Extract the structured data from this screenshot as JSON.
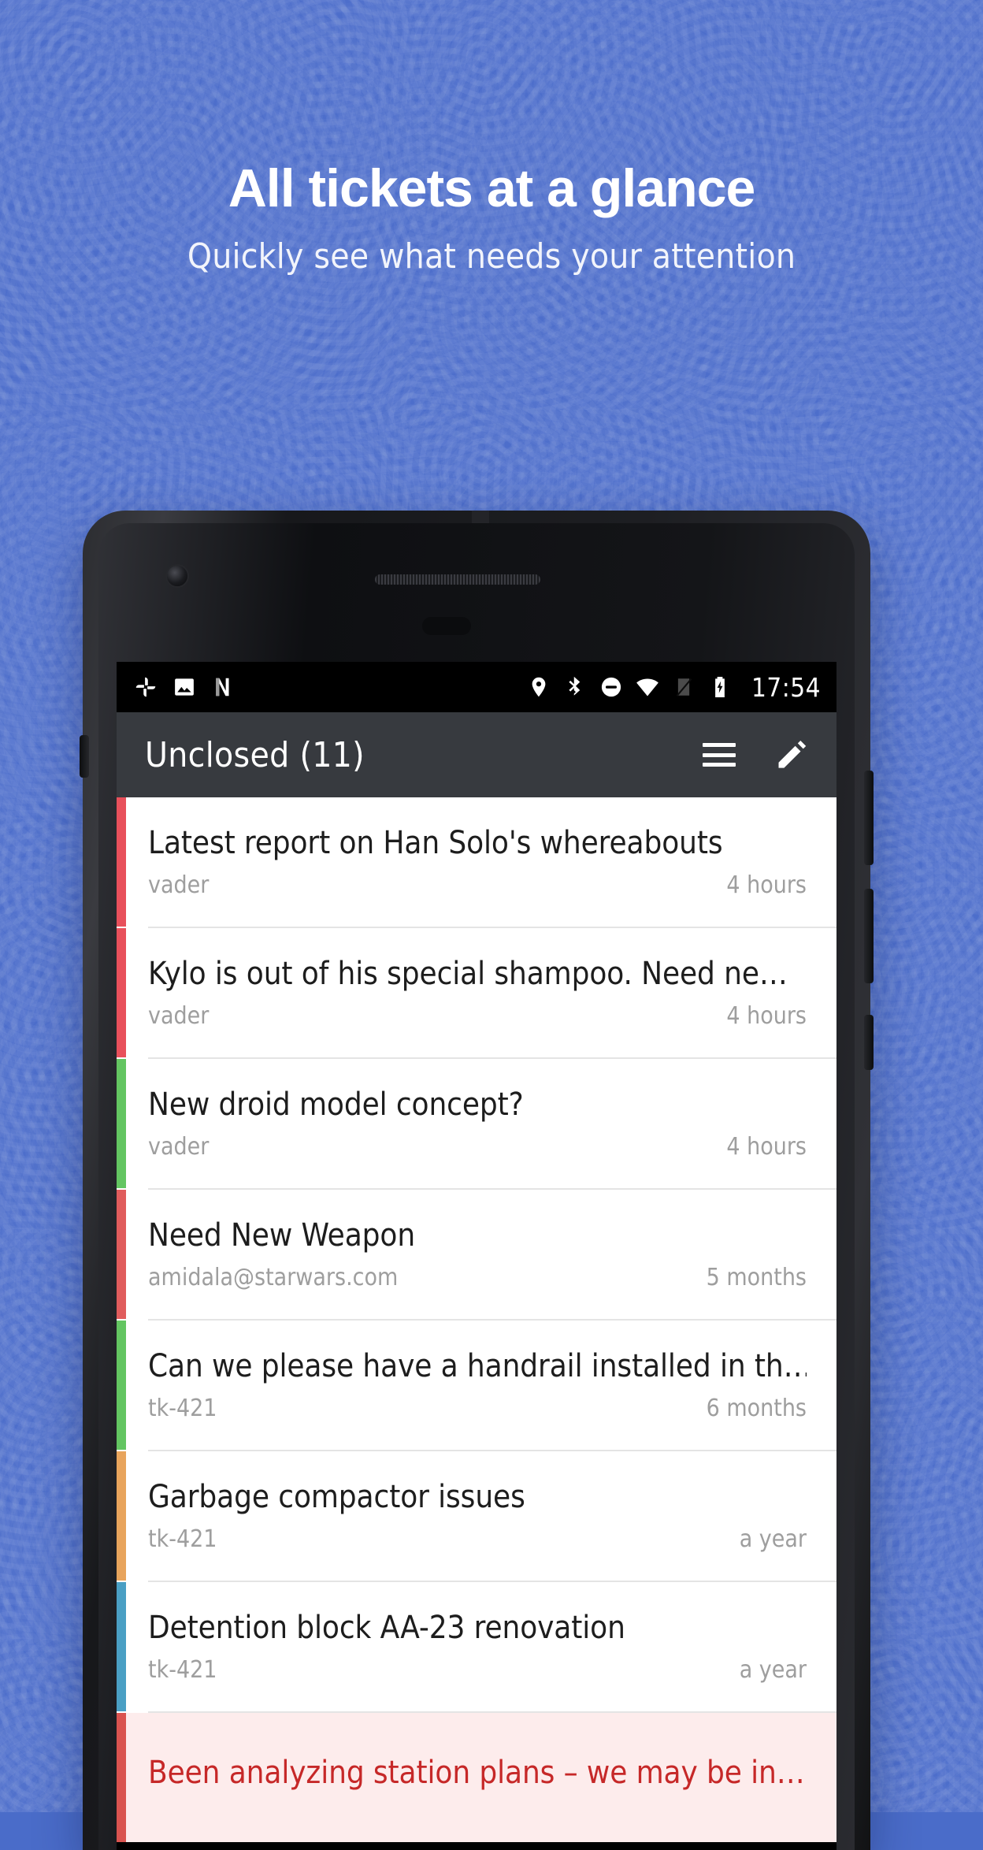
{
  "hero": {
    "title": "All tickets at a glance",
    "subtitle": "Quickly see what needs your attention",
    "background_color": "#4d6ecb",
    "title_color": "#ffffff"
  },
  "status_bar": {
    "icons_left": [
      "photos-pinwheel-icon",
      "gallery-image-icon",
      "netflix-n-icon"
    ],
    "icons_right": [
      "location-pin-icon",
      "bluetooth-icon",
      "do-not-disturb-icon",
      "wifi-icon",
      "no-signal-icon",
      "battery-charging-icon"
    ],
    "clock": "17:54",
    "background_color": "#000000"
  },
  "app_bar": {
    "title": "Unclosed (11)",
    "background_color": "#373a3f",
    "actions": [
      {
        "name": "menu-button",
        "icon": "hamburger-icon"
      },
      {
        "name": "compose-button",
        "icon": "pencil-icon"
      }
    ]
  },
  "tickets": [
    {
      "title": "Latest report on Han Solo's whereabouts",
      "author": "vader",
      "age": "4 hours",
      "accent": "#e8505b",
      "urgent": false
    },
    {
      "title": "Kylo is out of his special shampoo. Need ne…",
      "author": "vader",
      "age": "4 hours",
      "accent": "#e8505b",
      "urgent": false
    },
    {
      "title": "New droid model concept?",
      "author": "vader",
      "age": "4 hours",
      "accent": "#63c561",
      "urgent": false
    },
    {
      "title": "Need New Weapon",
      "author": "amidala@starwars.com",
      "age": "5 months",
      "accent": "#e05c5c",
      "urgent": false
    },
    {
      "title": "Can we please have a handrail installed in th…",
      "author": "tk-421",
      "age": "6 months",
      "accent": "#63c561",
      "urgent": false
    },
    {
      "title": "Garbage compactor issues",
      "author": "tk-421",
      "age": "a year",
      "accent": "#e8a45c",
      "urgent": false
    },
    {
      "title": "Detention block AA-23 renovation",
      "author": "tk-421",
      "age": "a year",
      "accent": "#4a9fc4",
      "urgent": false
    },
    {
      "title": "Been analyzing station plans – we may be in…",
      "author": "",
      "age": "",
      "accent": "#d9534f",
      "urgent": true
    }
  ]
}
